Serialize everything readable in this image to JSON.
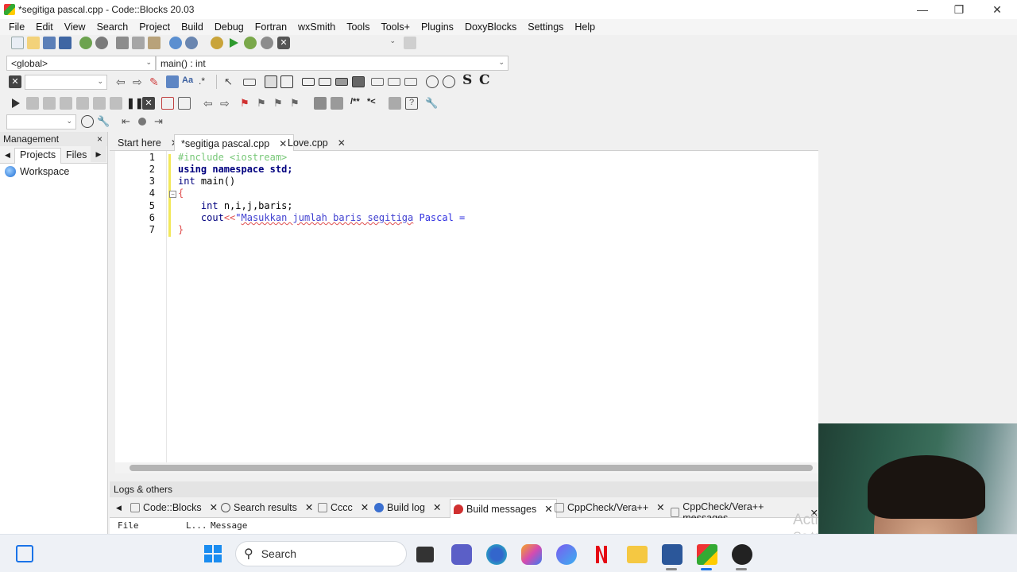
{
  "window": {
    "title": "*segitiga pascal.cpp - Code::Blocks 20.03"
  },
  "menu": [
    "File",
    "Edit",
    "View",
    "Search",
    "Project",
    "Build",
    "Debug",
    "Fortran",
    "wxSmith",
    "Tools",
    "Tools+",
    "Plugins",
    "DoxyBlocks",
    "Settings",
    "Help"
  ],
  "scope_combo": "<global>",
  "function_combo": "main() : int",
  "toolbar_text": {
    "s_button": "S",
    "c_button": "C"
  },
  "management": {
    "title": "Management",
    "tabs": [
      "Projects",
      "Files"
    ],
    "workspace": "Workspace"
  },
  "editor_tabs": [
    {
      "label": "Start here"
    },
    {
      "label": "*segitiga pascal.cpp"
    },
    {
      "label": "Love.cpp"
    }
  ],
  "line_numbers": [
    "1",
    "2",
    "3",
    "4",
    "5",
    "6",
    "7"
  ],
  "code": {
    "l1": "#include <iostream>",
    "l2_kw1": "using",
    "l2_kw2": "namespace",
    "l2_rest": "std;",
    "l3_type": "int",
    "l3_rest": " main()",
    "l4": "{",
    "l5_type": "int",
    "l5_rest": " n,i,j,baris;",
    "l6_ident": "cout",
    "l6_op": "<<",
    "l6_str1": "\"",
    "l6_str2": "Masukkan jumlah baris segitiga",
    "l6_str3": " Pascal = ",
    "l7": "}"
  },
  "logs": {
    "title": "Logs & others",
    "tabs": [
      "Code::Blocks",
      "Search results",
      "Cccc",
      "Build log",
      "Build messages",
      "CppCheck/Vera++",
      "CppCheck/Vera++ messages"
    ],
    "columns": [
      "File",
      "L...",
      "Message"
    ]
  },
  "watermark": [
    "Acti",
    "Go to"
  ],
  "taskbar": {
    "search_placeholder": "Search"
  },
  "colors": {
    "keyword": "#00007f",
    "preprocessor": "#78c878",
    "string": "#3030e0",
    "operator": "#e05050"
  }
}
